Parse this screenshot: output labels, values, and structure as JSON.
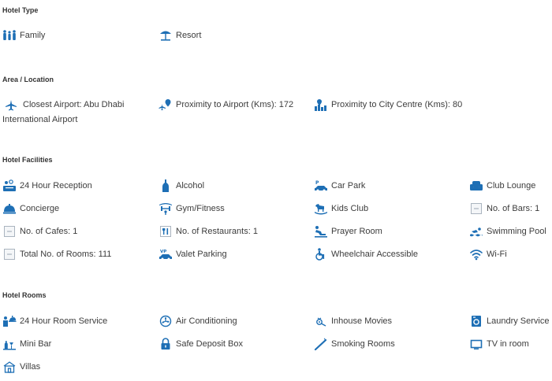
{
  "accent_color": "#1e6fb5",
  "sections": {
    "hotel_type": {
      "title": "Hotel Type",
      "items": [
        {
          "label": "Family",
          "icon": "family-icon"
        },
        {
          "label": "Resort",
          "icon": "beach-umbrella-icon"
        }
      ]
    },
    "area_location": {
      "title": "Area / Location",
      "items": [
        {
          "label": "Closest Airport: Abu Dhabi International Airport",
          "icon": "airplane-icon"
        },
        {
          "label": "Proximity to Airport (Kms): 172",
          "icon": "airport-pin-icon"
        },
        {
          "label": "Proximity to City Centre (Kms): 80",
          "icon": "city-pin-icon"
        }
      ]
    },
    "hotel_facilities": {
      "title": "Hotel Facilities",
      "items": [
        {
          "label": "24 Hour Reception",
          "icon": "reception-icon"
        },
        {
          "label": "Alcohol",
          "icon": "bottle-icon"
        },
        {
          "label": "Car Park",
          "icon": "car-park-icon"
        },
        {
          "label": "Club Lounge",
          "icon": "armchair-icon"
        },
        {
          "label": "Concierge",
          "icon": "bell-icon"
        },
        {
          "label": "Gym/Fitness",
          "icon": "dumbbell-icon"
        },
        {
          "label": "Kids Club",
          "icon": "rocking-horse-icon"
        },
        {
          "label": "No. of Bars: 1",
          "icon": "placeholder-icon"
        },
        {
          "label": "No. of Cafes: 1",
          "icon": "placeholder-icon"
        },
        {
          "label": "No. of Restaurants: 1",
          "icon": "cutlery-icon"
        },
        {
          "label": "Prayer Room",
          "icon": "prayer-icon"
        },
        {
          "label": "Swimming Pool",
          "icon": "swimmer-icon"
        },
        {
          "label": "Total No. of Rooms: 111",
          "icon": "placeholder-icon"
        },
        {
          "label": "Valet Parking",
          "icon": "valet-car-icon"
        },
        {
          "label": "Wheelchair Accessible",
          "icon": "wheelchair-icon"
        },
        {
          "label": "Wi-Fi",
          "icon": "wifi-icon"
        }
      ]
    },
    "hotel_rooms": {
      "title": "Hotel Rooms",
      "items": [
        {
          "label": "24 Hour Room Service",
          "icon": "room-service-icon"
        },
        {
          "label": "Air Conditioning",
          "icon": "fan-icon"
        },
        {
          "label": "Inhouse Movies",
          "icon": "film-reel-icon"
        },
        {
          "label": "Laundry Service",
          "icon": "washing-machine-icon"
        },
        {
          "label": "Mini Bar",
          "icon": "minibar-icon"
        },
        {
          "label": "Safe Deposit Box",
          "icon": "lock-icon"
        },
        {
          "label": "Smoking Rooms",
          "icon": "cigarette-icon"
        },
        {
          "label": "TV in room",
          "icon": "tv-icon"
        },
        {
          "label": "Villas",
          "icon": "villa-icon"
        }
      ]
    }
  }
}
